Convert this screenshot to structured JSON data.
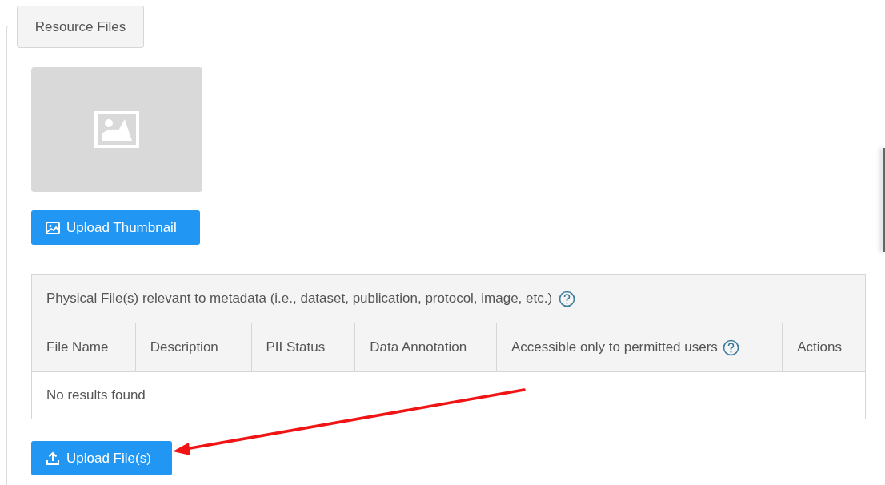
{
  "section": {
    "legend": "Resource Files"
  },
  "thumbnail_button": {
    "label": "Upload Thumbnail"
  },
  "table": {
    "title": "Physical File(s) relevant to metadata (i.e., dataset, publication, protocol, image, etc.)",
    "title_help": true,
    "columns": [
      {
        "label": "File Name",
        "help": false
      },
      {
        "label": "Description",
        "help": false
      },
      {
        "label": "PII Status",
        "help": false
      },
      {
        "label": "Data Annotation",
        "help": false
      },
      {
        "label": "Accessible only to permitted users",
        "help": true
      },
      {
        "label": "Actions",
        "help": false
      }
    ],
    "empty_message": "No results found"
  },
  "upload_button": {
    "label": "Upload File(s)"
  }
}
